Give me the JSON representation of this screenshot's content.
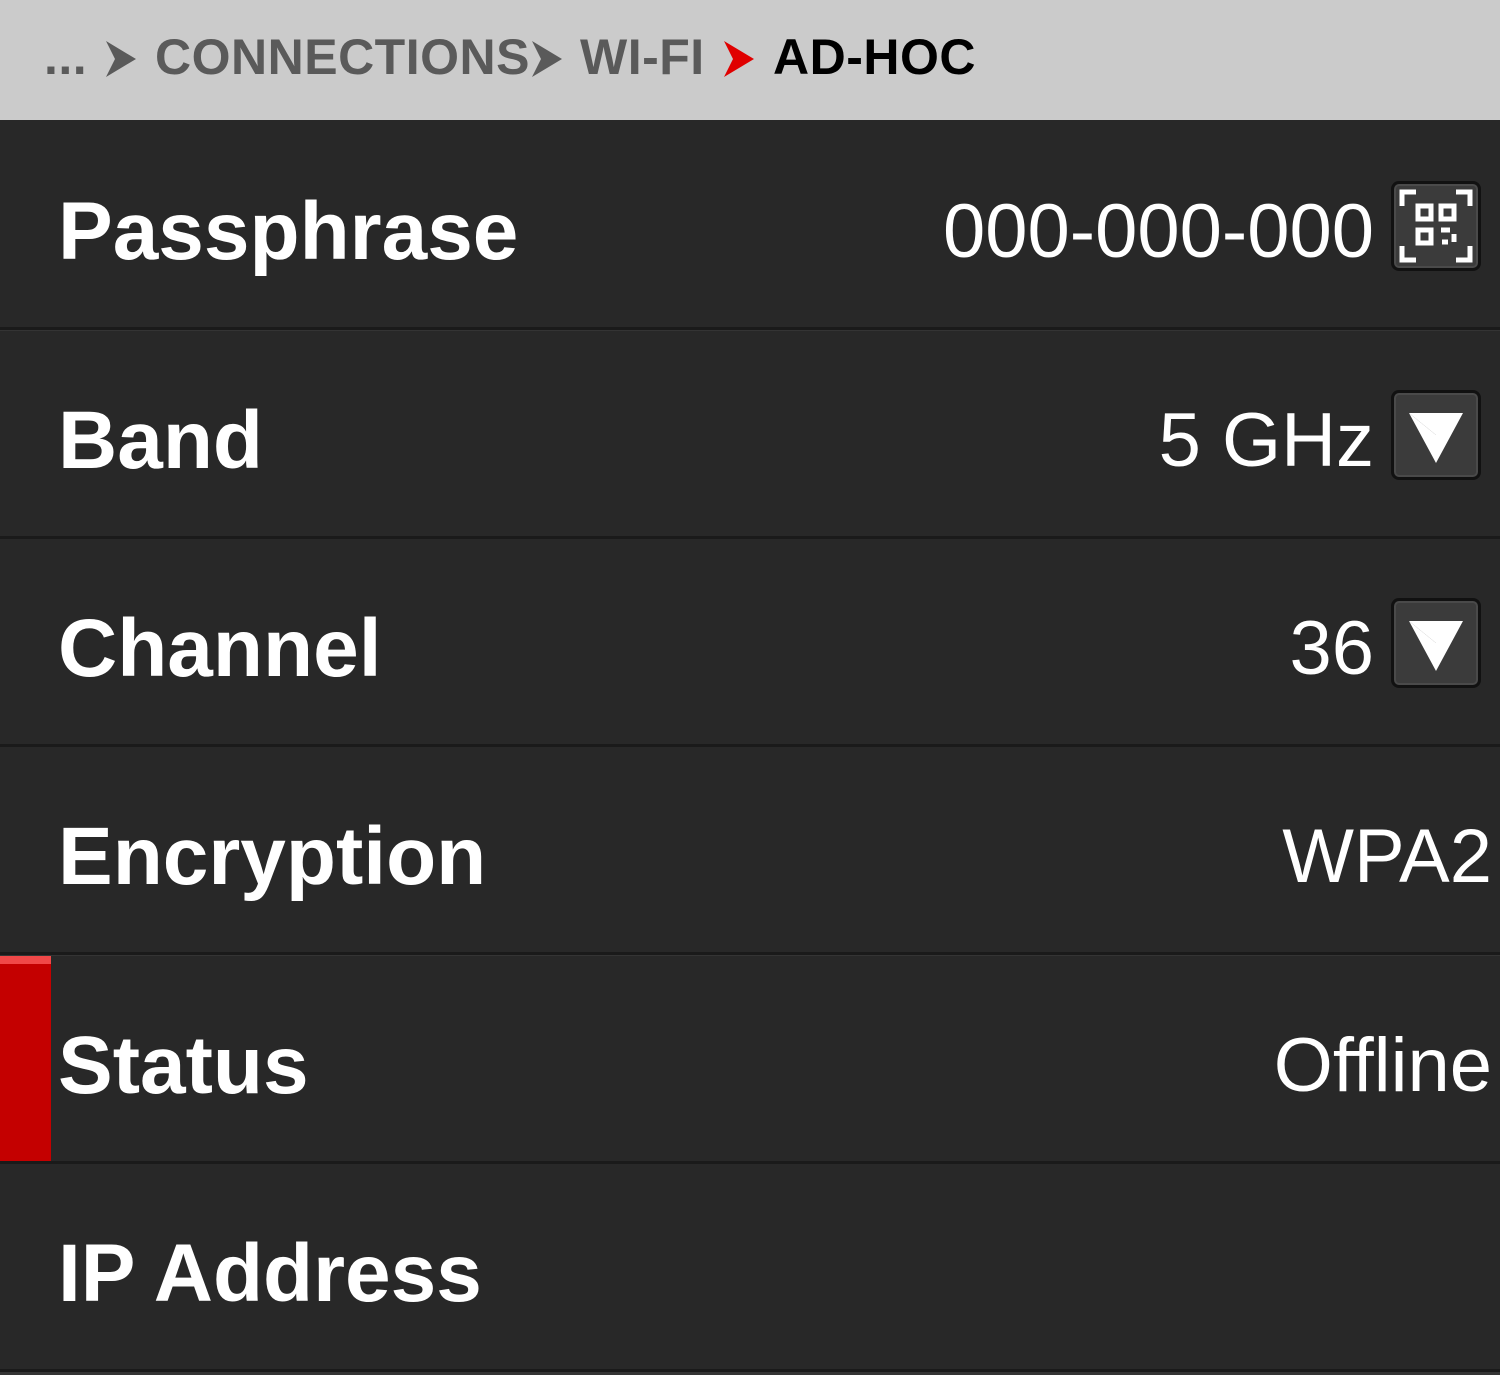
{
  "breadcrumb": {
    "ellipsis": "...",
    "items": [
      "CONNECTIONS",
      "WI-FI"
    ],
    "current": "AD-HOC",
    "separator_color": "#5a5a5a",
    "current_separator_color": "#e00000"
  },
  "settings": {
    "passphrase": {
      "label": "Passphrase",
      "value": "000-000-000",
      "action_icon": "qr-code-icon"
    },
    "band": {
      "label": "Band",
      "value": "5 GHz",
      "action_icon": "dropdown-arrow-icon"
    },
    "channel": {
      "label": "Channel",
      "value": "36",
      "action_icon": "dropdown-arrow-icon"
    },
    "encryption": {
      "label": "Encryption",
      "value": "WPA2"
    },
    "status": {
      "label": "Status",
      "value": "Offline",
      "accent_color": "#c40000"
    },
    "ip_address": {
      "label": "IP Address",
      "value": ""
    }
  }
}
